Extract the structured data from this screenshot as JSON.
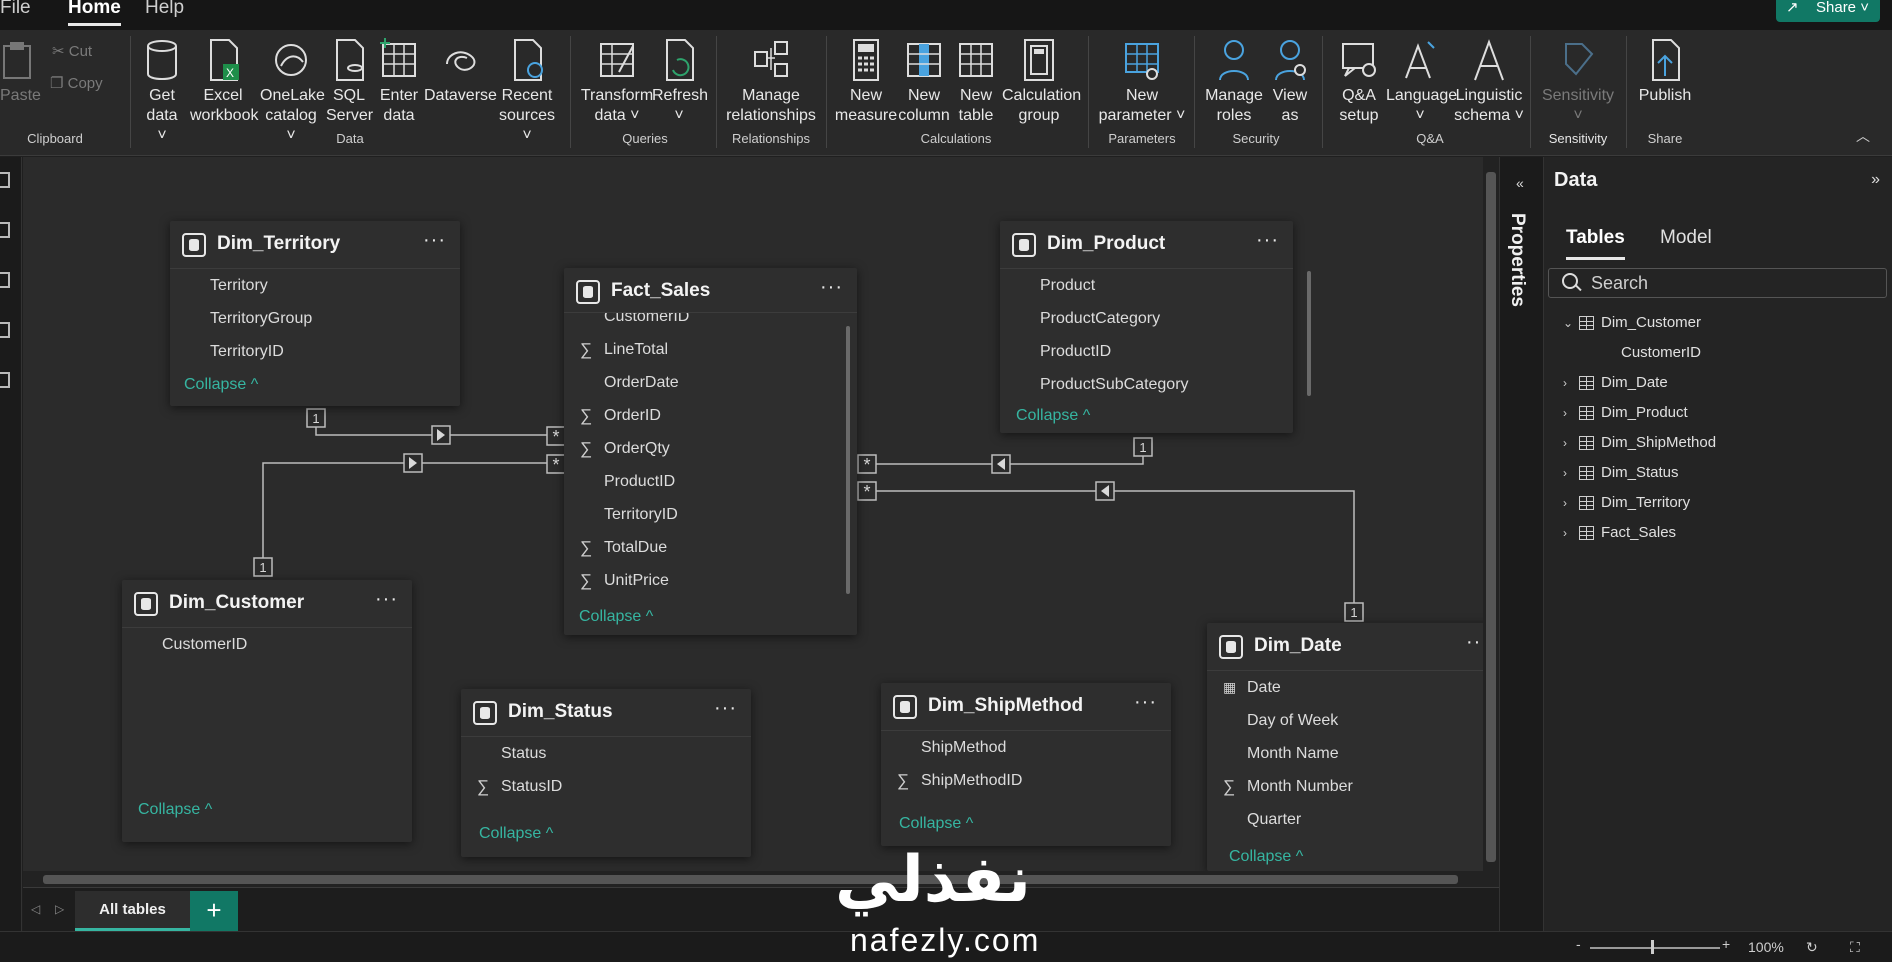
{
  "menu": {
    "file": "File",
    "home": "Home",
    "help": "Help",
    "share": "Share"
  },
  "ribbon": {
    "clipboard": {
      "paste": "Paste",
      "cut": "Cut",
      "copy": "Copy",
      "label": "Clipboard"
    },
    "data": {
      "get_data": [
        "Get",
        "data ˅"
      ],
      "excel": [
        "Excel",
        "workbook"
      ],
      "onelake": [
        "OneLake",
        "catalog ˅"
      ],
      "sql": [
        "SQL",
        "Server"
      ],
      "enter": [
        "Enter",
        "data"
      ],
      "dataverse": [
        "Dataverse",
        ""
      ],
      "recent": [
        "Recent",
        "sources ˅"
      ],
      "label": "Data"
    },
    "queries": {
      "transform": [
        "Transform",
        "data ˅"
      ],
      "refresh": [
        "Refresh",
        "˅"
      ],
      "label": "Queries"
    },
    "relationships": {
      "manage": [
        "Manage",
        "relationships"
      ],
      "label": "Relationships"
    },
    "calculations": {
      "new_measure": [
        "New",
        "measure"
      ],
      "new_column": [
        "New",
        "column"
      ],
      "new_table": [
        "New",
        "table"
      ],
      "calc_group": [
        "Calculation",
        "group"
      ],
      "label": "Calculations"
    },
    "parameters": {
      "new_param": [
        "New",
        "parameter ˅"
      ],
      "label": "Parameters"
    },
    "security": {
      "manage_roles": [
        "Manage",
        "roles"
      ],
      "view_as": [
        "View",
        "as"
      ],
      "label": "Security"
    },
    "qa": {
      "qa_setup": [
        "Q&A",
        "setup"
      ],
      "language": [
        "Language",
        "˅"
      ],
      "linguistic": [
        "Linguistic",
        "schema ˅"
      ],
      "label": "Q&A"
    },
    "sensitivity": {
      "btn": [
        "Sensitivity",
        "˅"
      ],
      "label": "Sensitivity"
    },
    "share": {
      "publish": [
        "Publish",
        ""
      ],
      "label": "Share"
    }
  },
  "tables": {
    "dim_territory": {
      "title": "Dim_Territory",
      "fields": [
        "Territory",
        "TerritoryGroup",
        "TerritoryID"
      ],
      "collapse": "Collapse ^"
    },
    "fact_sales": {
      "title": "Fact_Sales",
      "fields": [
        "CustomerID",
        "LineTotal",
        "OrderDate",
        "OrderID",
        "OrderQty",
        "ProductID",
        "TerritoryID",
        "TotalDue",
        "UnitPrice"
      ],
      "collapse": "Collapse ^"
    },
    "dim_product": {
      "title": "Dim_Product",
      "fields": [
        "Product",
        "ProductCategory",
        "ProductID",
        "ProductSubCategory"
      ],
      "collapse": "Collapse ^"
    },
    "dim_customer": {
      "title": "Dim_Customer",
      "fields": [
        "CustomerID"
      ],
      "collapse": "Collapse ^"
    },
    "dim_status": {
      "title": "Dim_Status",
      "fields": [
        "Status",
        "StatusID"
      ],
      "collapse": "Collapse ^"
    },
    "dim_shipmethod": {
      "title": "Dim_ShipMethod",
      "fields": [
        "ShipMethod",
        "ShipMethodID"
      ],
      "collapse": "Collapse ^"
    },
    "dim_date": {
      "title": "Dim_Date",
      "fields": [
        "Date",
        "Day of Week",
        "Month Name",
        "Month Number",
        "Quarter"
      ],
      "collapse": "Collapse ^"
    }
  },
  "relationship_markers": {
    "one": "1",
    "many": "*"
  },
  "tabs": {
    "all_tables": "All tables",
    "add": "+"
  },
  "properties_label": "Properties",
  "data_pane": {
    "title": "Data",
    "tab_tables": "Tables",
    "tab_model": "Model",
    "search_placeholder": "Search",
    "tree": [
      {
        "label": "Dim_Customer",
        "expanded": true
      },
      {
        "label": "CustomerID",
        "child": true
      },
      {
        "label": "Dim_Date"
      },
      {
        "label": "Dim_Product"
      },
      {
        "label": "Dim_ShipMethod"
      },
      {
        "label": "Dim_Status"
      },
      {
        "label": "Dim_Territory"
      },
      {
        "label": "Fact_Sales"
      }
    ]
  },
  "status": {
    "zoom": "100%",
    "minus": "-",
    "plus": "+"
  },
  "watermark": {
    "arabic": "نفذلي",
    "latin": "nafezly.com"
  },
  "colors": {
    "accent": "#36b5a1",
    "brand": "#117865"
  }
}
